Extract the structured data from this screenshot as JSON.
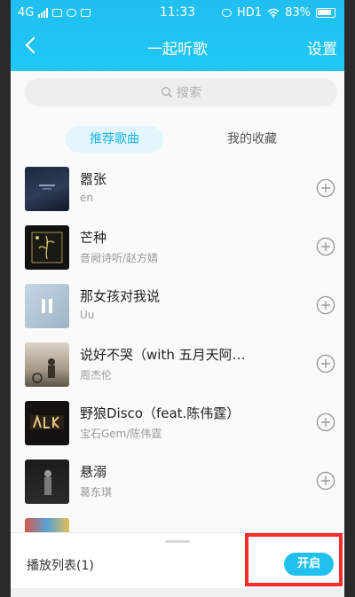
{
  "status_bar": {
    "network": "4G",
    "time": "11:33",
    "hd": "HD1",
    "battery": "83%"
  },
  "nav": {
    "title": "一起听歌",
    "settings_label": "设置"
  },
  "search": {
    "placeholder": "搜索"
  },
  "tabs": [
    {
      "label": "推荐歌曲",
      "active": true
    },
    {
      "label": "我的收藏",
      "active": false
    }
  ],
  "songs": [
    {
      "title": "嚣张",
      "artist": "en",
      "icon": "plus-circle-icon"
    },
    {
      "title": "芒种",
      "artist": "音阙诗听/赵方婧",
      "icon": "plus-circle-icon"
    },
    {
      "title": "那女孩对我说",
      "artist": "Uu",
      "icon": "plus-circle-icon"
    },
    {
      "title": "说好不哭（with 五月天阿…",
      "artist": "周杰伦",
      "icon": "plus-circle-icon"
    },
    {
      "title": "野狼Disco（feat.陈伟霆）",
      "artist": "宝石Gem/陈伟霆",
      "icon": "plus-circle-icon"
    },
    {
      "title": "悬溺",
      "artist": "葛东琪",
      "icon": "plus-circle-icon"
    }
  ],
  "bottom": {
    "playlist_label": "播放列表(1)",
    "open_label": "开启"
  },
  "colors": {
    "accent": "#21c1ef",
    "highlight": "#ff2a2a"
  }
}
